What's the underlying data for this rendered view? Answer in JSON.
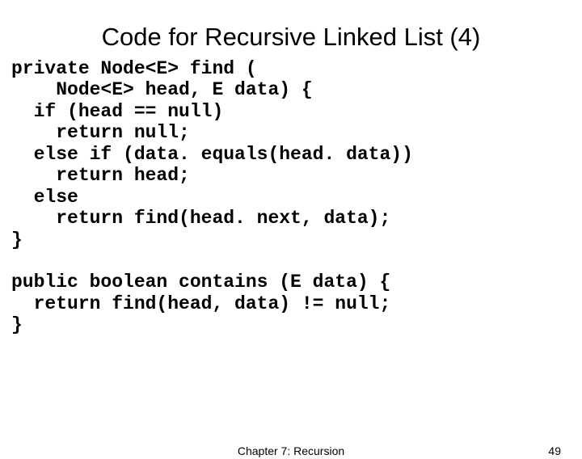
{
  "title": "Code for Recursive Linked List (4)",
  "code": "private Node<E> find (\n    Node<E> head, E data) {\n  if (head == null)\n    return null;\n  else if (data. equals(head. data))\n    return head;\n  else\n    return find(head. next, data);\n}\n\npublic boolean contains (E data) {\n  return find(head, data) != null;\n}",
  "footer": {
    "chapter": "Chapter 7: Recursion",
    "page": "49"
  }
}
